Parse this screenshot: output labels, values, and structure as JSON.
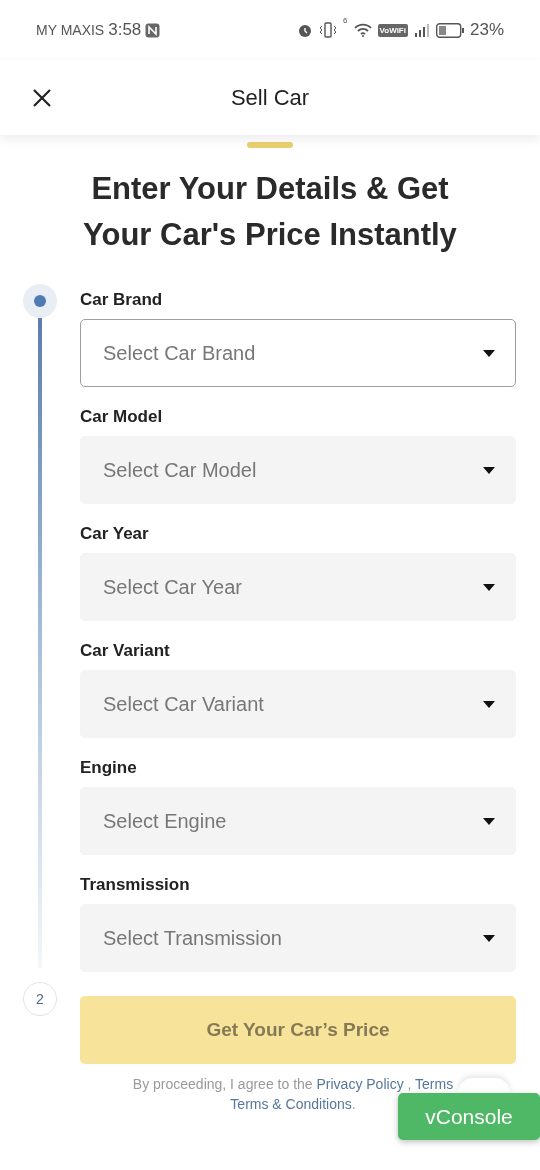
{
  "status_bar": {
    "carrier": "MY MAXIS",
    "time": "3:58",
    "vowifi": "VoWiFi",
    "network_gen": "6",
    "battery": "23%"
  },
  "header": {
    "title": "Sell Car"
  },
  "heading": "Enter Your Details & Get Your Car's Price Instantly",
  "steps": [
    {
      "kind": "dot",
      "selected": true
    },
    {
      "kind": "number",
      "label": "2",
      "selected": false
    }
  ],
  "fields": [
    {
      "label": "Car Brand",
      "placeholder": "Select Car Brand",
      "active": true
    },
    {
      "label": "Car Model",
      "placeholder": "Select Car Model",
      "active": false
    },
    {
      "label": "Car Year",
      "placeholder": "Select Car Year",
      "active": false
    },
    {
      "label": "Car Variant",
      "placeholder": "Select Car Variant",
      "active": false
    },
    {
      "label": "Engine",
      "placeholder": "Select Engine",
      "active": false
    },
    {
      "label": "Transmission",
      "placeholder": "Select Transmission",
      "active": false
    }
  ],
  "submit_button": "Get Your Car’s Price",
  "disclaimer": [
    [
      {
        "text": "By proceeding, I agree to the ",
        "link": false
      },
      {
        "text": "Privacy Policy",
        "link": true
      },
      {
        "text": " , ",
        "link": false
      },
      {
        "text": "Terms",
        "link": true
      }
    ],
    [
      {
        "text": "Terms & Conditions",
        "link": true
      },
      {
        "text": ".",
        "link": false
      }
    ]
  ],
  "vconsole_button": "vConsole"
}
